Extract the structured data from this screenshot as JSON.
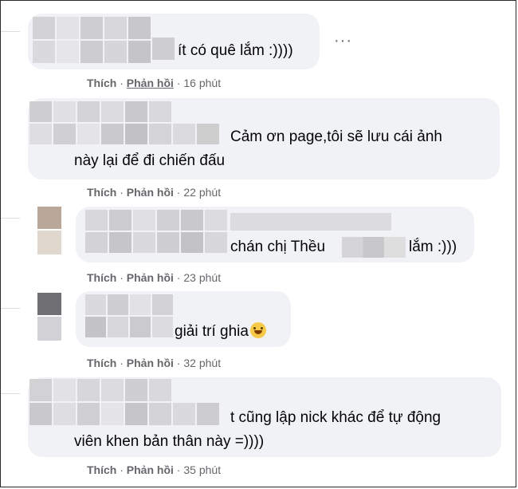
{
  "comments": [
    {
      "text_lines": [
        "ít có quê lắm :))))"
      ],
      "like_label": "Thích",
      "reply_label": "Phản hồi",
      "time": "16 phút"
    },
    {
      "text_lines": [
        "Cảm ơn page,tôi sẽ lưu cái ảnh",
        "này lại để đi chiến đấu"
      ],
      "like_label": "Thích",
      "reply_label": "Phản hồi",
      "time": "22 phút"
    },
    {
      "text_lines": [
        "chán chị Thều",
        "lắm :)))"
      ],
      "like_label": "Thích",
      "reply_label": "Phản hồi",
      "time": "23 phút"
    },
    {
      "text_lines": [
        "giải trí ghia"
      ],
      "emoji": "laughing-emoji",
      "like_label": "Thích",
      "reply_label": "Phản hồi",
      "time": "32 phút"
    },
    {
      "text_lines": [
        "t cũng lập nick khác để tự động",
        "viên khen bản thân này =))))"
      ],
      "like_label": "Thích",
      "reply_label": "Phản hồi",
      "time": "35 phút"
    }
  ],
  "more_options": "···",
  "separator": " · "
}
